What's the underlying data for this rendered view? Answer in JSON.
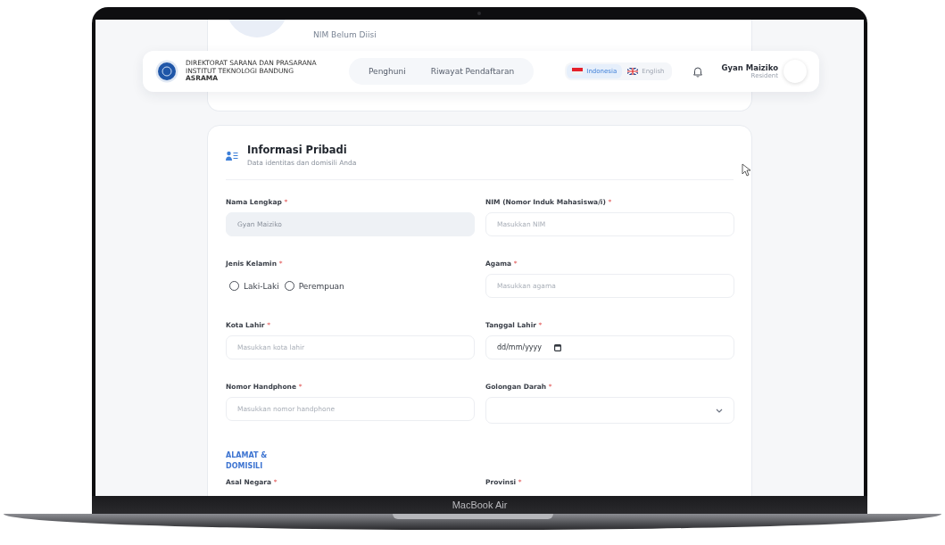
{
  "laptop": {
    "model_label": "MacBook Air"
  },
  "background_card": {
    "status": "NIM Belum Diisi"
  },
  "header": {
    "logo_lines": [
      "DIREKTORAT SARANA DAN PRASARANA",
      "INSTITUT TEKNOLOGI BANDUNG",
      "ASRAMA"
    ],
    "nav": [
      {
        "label": "Penghuni",
        "selected": false
      },
      {
        "label": "Riwayat Pendaftaran",
        "selected": false
      }
    ],
    "languages": [
      {
        "label": "Indonesia",
        "selected": true,
        "kind": "id"
      },
      {
        "label": "English",
        "selected": false,
        "kind": "gb"
      }
    ],
    "user": {
      "name": "Gyan Maiziko",
      "role": "Resident"
    }
  },
  "form": {
    "title": "Informasi Pribadi",
    "subtitle": "Data identitas dan domisili Anda",
    "required_mark": "*",
    "fields": [
      {
        "kind": "text",
        "label": "Nama Lengkap",
        "required": true,
        "value": "Gyan Maiziko",
        "disabled": true
      },
      {
        "kind": "text",
        "label": "NIM (Nomor Induk Mahasiswa/i)",
        "required": true,
        "placeholder": "Masukkan NIM",
        "disabled": false
      },
      {
        "kind": "radio",
        "label": "Jenis Kelamin",
        "required": true,
        "options": [
          {
            "label": "Laki-Laki",
            "selected": false
          },
          {
            "label": "Perempuan",
            "selected": false
          }
        ]
      },
      {
        "kind": "text",
        "label": "Agama",
        "required": true,
        "placeholder": "Masukkan agama",
        "disabled": false
      },
      {
        "kind": "text",
        "label": "Kota Lahir",
        "required": true,
        "placeholder": "Masukkan kota lahir",
        "disabled": false
      },
      {
        "kind": "date",
        "label": "Tanggal Lahir",
        "required": true,
        "format": "dd/mm/yyyy"
      },
      {
        "kind": "text",
        "label": "Nomor Handphone",
        "required": true,
        "placeholder": "Masukkan nomor handphone",
        "disabled": false
      },
      {
        "kind": "select",
        "label": "Golongan Darah",
        "required": true
      }
    ],
    "section_heading": "ALAMAT & DOMISILI",
    "next_fields": [
      {
        "label": "Asal Negara",
        "required": true
      },
      {
        "label": "Provinsi",
        "required": true
      }
    ]
  }
}
